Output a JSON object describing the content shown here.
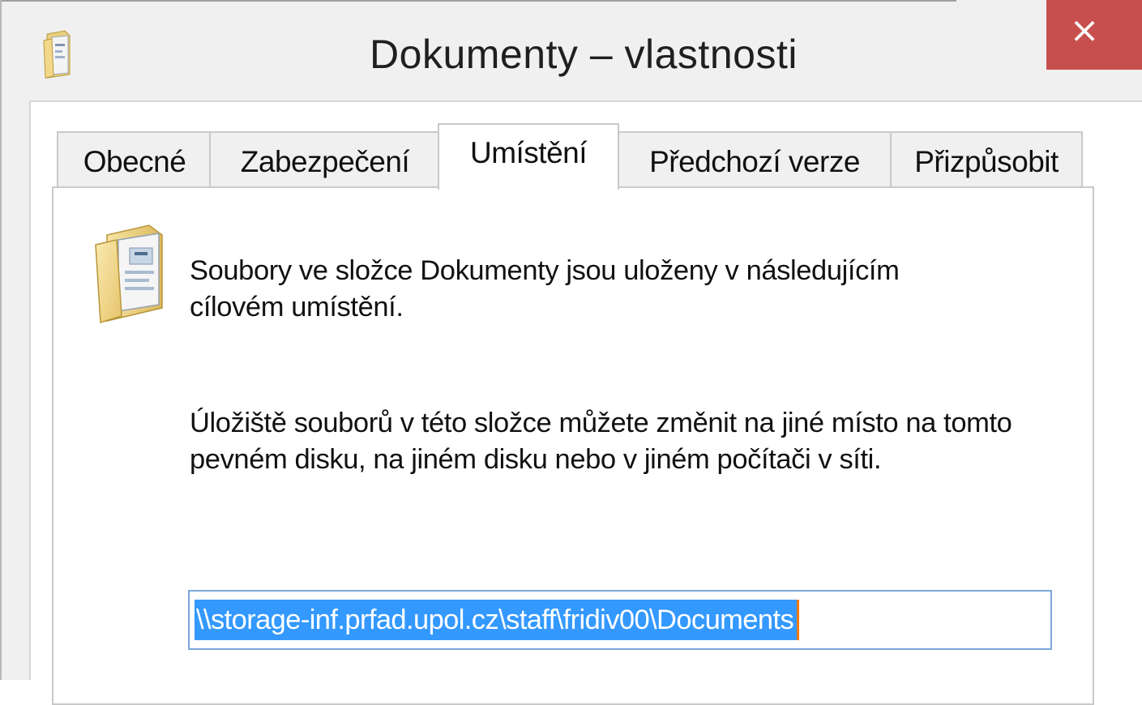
{
  "window": {
    "title": "Dokumenty – vlastnosti",
    "close_glyph": "×",
    "close_color": "#c7504f"
  },
  "tabs": [
    {
      "label": "Obecné",
      "active": false
    },
    {
      "label": "Zabezpečení",
      "active": false
    },
    {
      "label": "Umístění",
      "active": true
    },
    {
      "label": "Předchozí verze",
      "active": false
    },
    {
      "label": "Přizpůsobit",
      "active": false
    }
  ],
  "location_tab": {
    "icon": "documents-folder-icon",
    "intro_text": "Soubory ve složce Dokumenty jsou uloženy v následujícím cílovém umístění.",
    "info_text": "Úložiště souborů v této složce můžete změnit na jiné místo na tomto pevném disku, na jiném disku nebo v jiném počítači v síti.",
    "path_value": "\\\\storage-inf.prfad.upol.cz\\staff\\fridiv00\\Documents",
    "path_selected": true
  },
  "colors": {
    "selection": "#3399ff",
    "input_border": "#7aa7d9",
    "caret": "#f07a10"
  }
}
